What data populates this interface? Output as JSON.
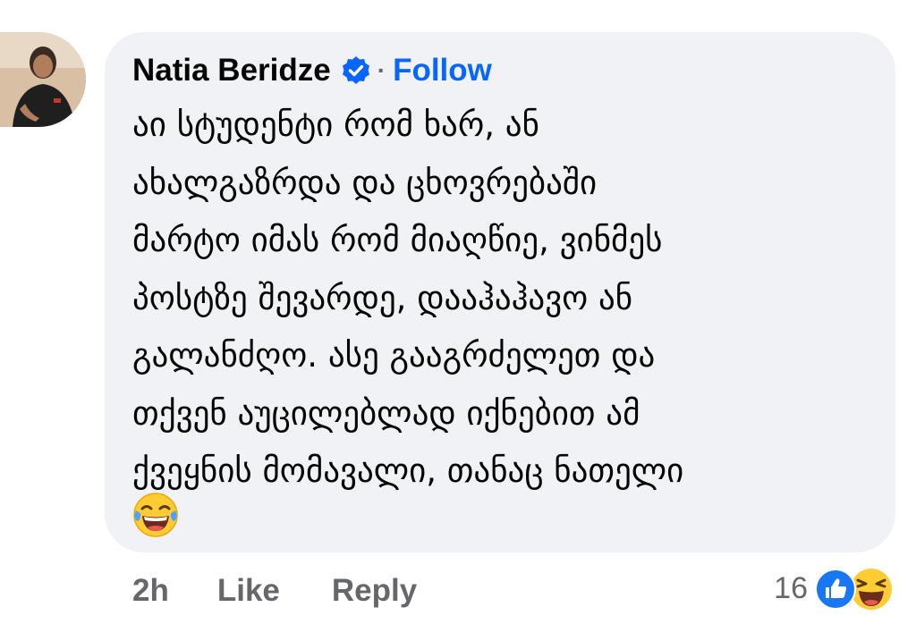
{
  "comment": {
    "author": "Natia Beridze",
    "separator": "·",
    "follow_label": "Follow",
    "text": "აი სტუდენტი რომ ხარ, ან\nახალგაზრდა და ცხოვრებაში\nმარტო იმას რომ მიაღწიე, ვინმეს\nპოსტზე შევარდე, დააჰაჰავო ან\nგალანძღო. ასე გააგრძელეთ და\nთქვენ აუცილებლად იქნებით ამ\nქვეყნის მომავალი, თანაც ნათელი",
    "trailing_emoji": "face-with-tears-of-joy"
  },
  "actions": {
    "time": "2h",
    "like_label": "Like",
    "reply_label": "Reply"
  },
  "reactions": {
    "count": "16",
    "icons": [
      "like-reaction-icon",
      "haha-reaction-icon"
    ]
  },
  "colors": {
    "bubble": "#f0f2f5",
    "link": "#0866ff",
    "secondary_text": "#65676b",
    "verified": "#0866ff"
  }
}
